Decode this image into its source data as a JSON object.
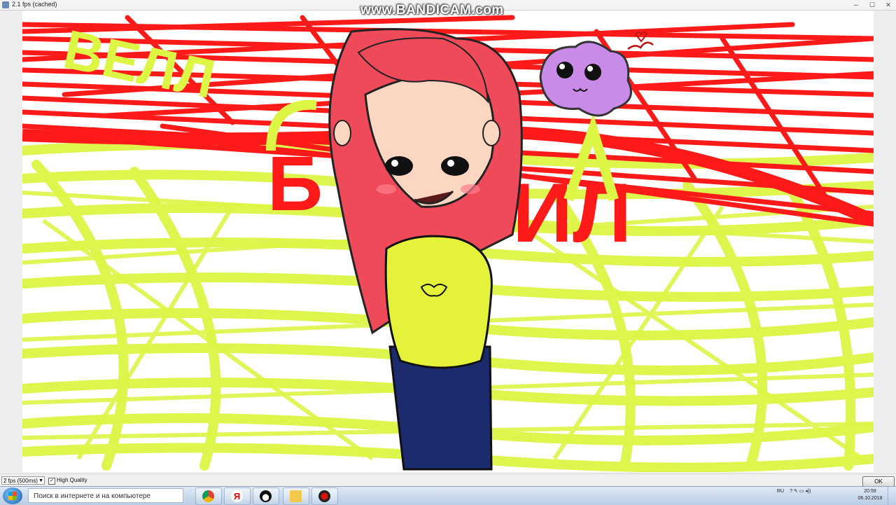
{
  "window": {
    "title": "2.1 fps (cached)",
    "minimize": "─",
    "maximize": "☐",
    "close": "✕"
  },
  "watermark": "www.BANDICAM.com",
  "drawing": {
    "text_yellow_1": "ВЕЛЛ",
    "text_red_1": "Б",
    "text_red_2": "ИЛ",
    "colors": {
      "red": "#ff1a1a",
      "yellow": "#ddf545",
      "hair": "#ee4a5a",
      "skin": "#fbd6c0",
      "sweater": "#e5f23a",
      "jeans": "#1c2a6e",
      "blob": "#c98ae8"
    }
  },
  "toolbar": {
    "fps_value": "2 fps (500ms)",
    "hq_checked": "✓",
    "hq_label": "High Quality",
    "ok_label": "OK"
  },
  "taskbar": {
    "search_placeholder": "Поиск в интернете и на компьютере",
    "apps": [
      "chrome-icon",
      "yandex-icon",
      "penguin-icon",
      "explorer-icon",
      "bandicam-record-icon"
    ],
    "yandex_letter": "Я",
    "lang": "RU",
    "time": "20:59",
    "date": "06.10.2018"
  }
}
